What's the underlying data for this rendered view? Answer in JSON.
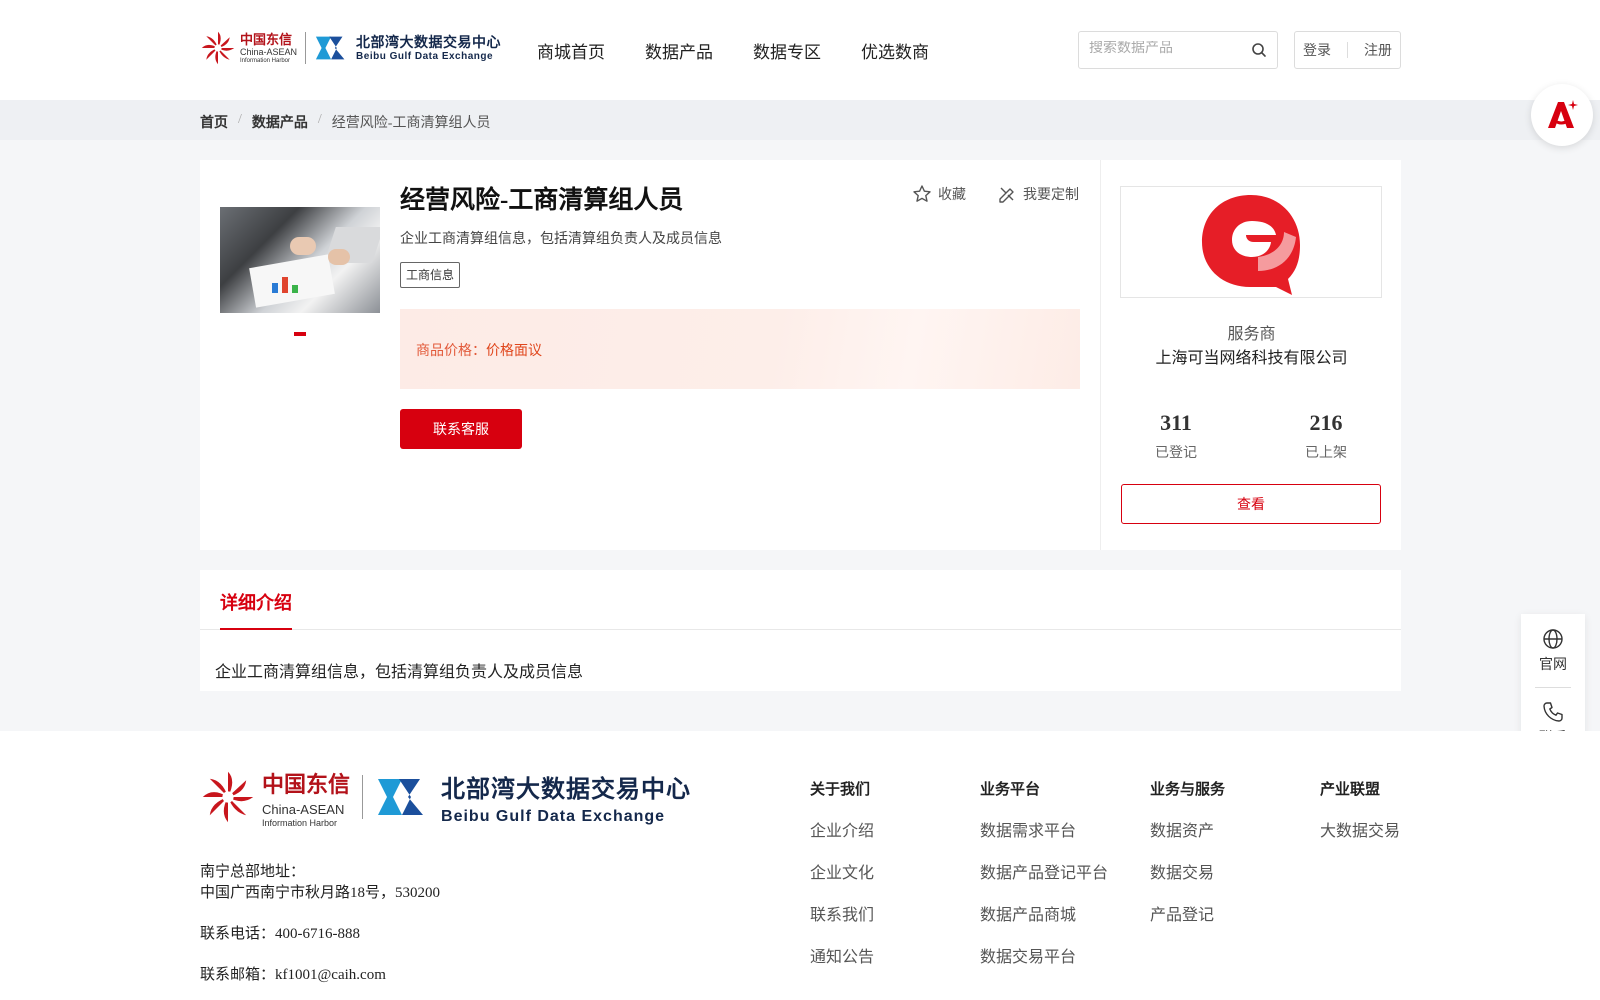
{
  "header": {
    "logo_cn": {
      "line1": "中国东信",
      "line2": "China-ASEAN",
      "line3": "Information Harbor"
    },
    "logo_bb": {
      "line1": "北部湾大数据交易中心",
      "line2": "Beibu Gulf Data Exchange"
    },
    "nav": [
      "商城首页",
      "数据产品",
      "数据专区",
      "优选数商"
    ],
    "search_placeholder": "搜索数据产品",
    "login": "登录",
    "register": "注册"
  },
  "breadcrumb": {
    "home": "首页",
    "category": "数据产品",
    "current": "经营风险-工商清算组人员"
  },
  "product": {
    "title": "经营风险-工商清算组人员",
    "favorite": "收藏",
    "customize": "我要定制",
    "description": "企业工商清算组信息，包括清算组负责人及成员信息",
    "tag": "工商信息",
    "price_label": "商品价格：",
    "price_value": "价格面议",
    "contact_button": "联系客服"
  },
  "provider": {
    "label": "服务商",
    "name": "上海可当网络科技有限公司",
    "stats": [
      {
        "value": "311",
        "label": "已登记"
      },
      {
        "value": "216",
        "label": "已上架"
      }
    ],
    "view_button": "查看"
  },
  "detail": {
    "tab": "详细介绍",
    "content": "企业工商清算组信息，包括清算组负责人及成员信息"
  },
  "float_bar": {
    "website": "官网",
    "contact": "联系"
  },
  "footer": {
    "address_label": "南宁总部地址：",
    "address": "中国广西南宁市秋月路18号，530200",
    "phone": "联系电话：400-6716-888",
    "email": "联系邮箱：kf1001@caih.com",
    "columns": [
      {
        "title": "关于我们",
        "links": [
          "企业介绍",
          "企业文化",
          "联系我们",
          "通知公告"
        ]
      },
      {
        "title": "业务平台",
        "links": [
          "数据需求平台",
          "数据产品登记平台",
          "数据产品商城",
          "数据交易平台"
        ]
      },
      {
        "title": "业务与服务",
        "links": [
          "数据资产",
          "数据交易",
          "产品登记"
        ]
      },
      {
        "title": "产业联盟",
        "links": [
          "大数据交易"
        ]
      }
    ]
  },
  "colors": {
    "accent": "#d7000f",
    "price": "#e0461c",
    "navy": "#14284b"
  },
  "icons": [
    "search-icon",
    "star-icon",
    "customize-icon",
    "globe-icon",
    "phone-icon",
    "ai-assistant-icon"
  ]
}
